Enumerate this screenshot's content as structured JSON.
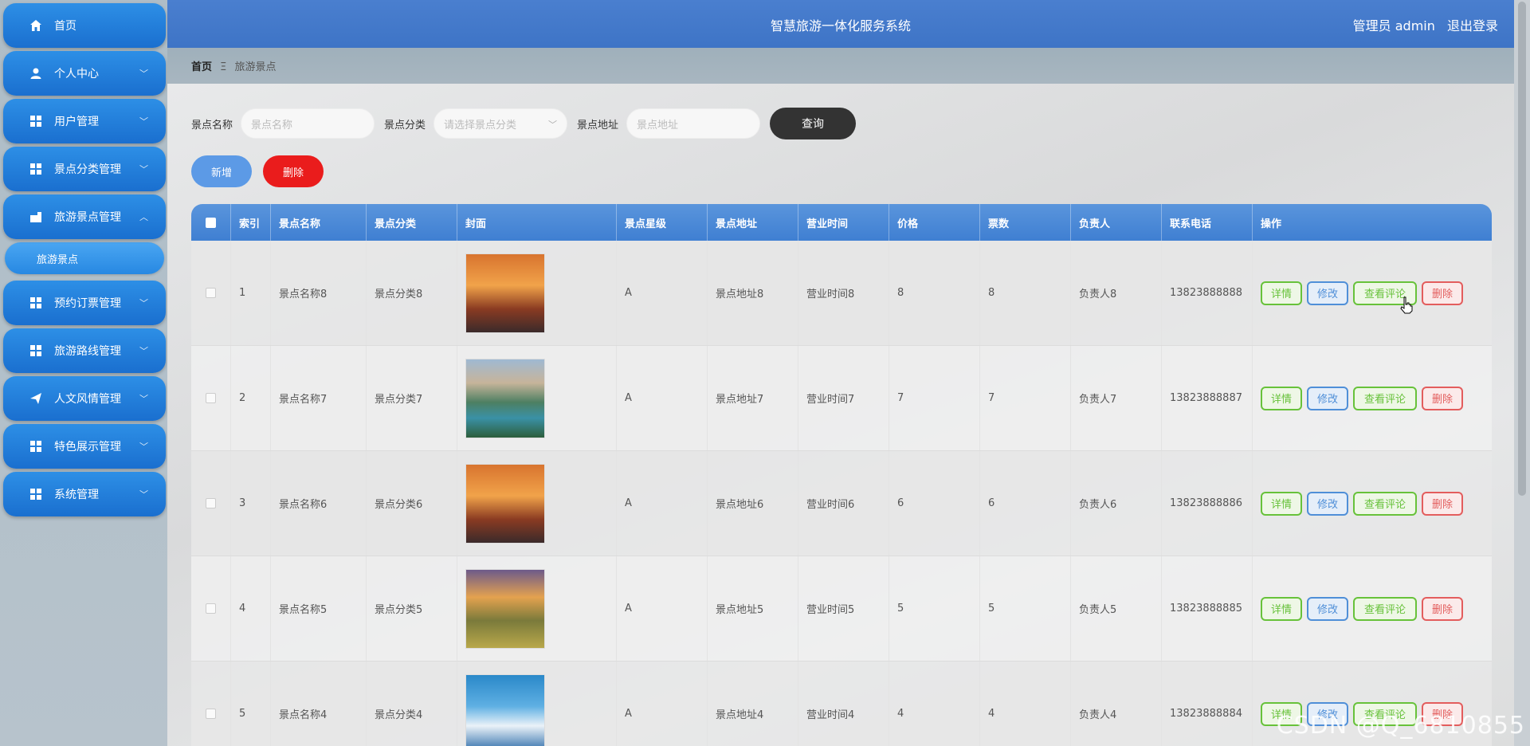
{
  "header": {
    "title": "智慧旅游一体化服务系统",
    "user_label": "管理员 admin",
    "logout_label": "退出登录"
  },
  "sidebar": {
    "items": [
      {
        "label": "首页",
        "icon": "home-icon"
      },
      {
        "label": "个人中心",
        "icon": "person-icon"
      },
      {
        "label": "用户管理",
        "icon": "grid-icon"
      },
      {
        "label": "景点分类管理",
        "icon": "grid-icon"
      },
      {
        "label": "旅游景点管理",
        "icon": "building-icon"
      },
      {
        "label": "预约订票管理",
        "icon": "grid-icon"
      },
      {
        "label": "旅游路线管理",
        "icon": "grid-icon"
      },
      {
        "label": "人文风情管理",
        "icon": "send-icon"
      },
      {
        "label": "特色展示管理",
        "icon": "grid-icon"
      },
      {
        "label": "系统管理",
        "icon": "grid-icon"
      }
    ],
    "submenu_active": "旅游景点"
  },
  "breadcrumb": {
    "home": "首页",
    "separator": "Ξ",
    "current": "旅游景点"
  },
  "search": {
    "name_label": "景点名称",
    "name_placeholder": "景点名称",
    "category_label": "景点分类",
    "category_placeholder": "请选择景点分类",
    "address_label": "景点地址",
    "address_placeholder": "景点地址",
    "query_label": "查询"
  },
  "actions": {
    "add_label": "新增",
    "delete_label": "删除"
  },
  "table": {
    "headers": [
      "索引",
      "景点名称",
      "景点分类",
      "封面",
      "景点星级",
      "景点地址",
      "营业时间",
      "价格",
      "票数",
      "负责人",
      "联系电话",
      "操作"
    ],
    "ops": {
      "detail": "详情",
      "edit": "修改",
      "review": "查看评论",
      "delete": "删除"
    },
    "rows": [
      {
        "index": "1",
        "name": "景点名称8",
        "category": "景点分类8",
        "cover": "sunset",
        "star": "A",
        "address": "景点地址8",
        "hours": "营业时间8",
        "price": "8",
        "tickets": "8",
        "owner": "负责人8",
        "phone": "13823888888"
      },
      {
        "index": "2",
        "name": "景点名称7",
        "category": "景点分类7",
        "cover": "lake",
        "star": "A",
        "address": "景点地址7",
        "hours": "营业时间7",
        "price": "7",
        "tickets": "7",
        "owner": "负责人7",
        "phone": "13823888887"
      },
      {
        "index": "3",
        "name": "景点名称6",
        "category": "景点分类6",
        "cover": "sunset",
        "star": "A",
        "address": "景点地址6",
        "hours": "营业时间6",
        "price": "6",
        "tickets": "6",
        "owner": "负责人6",
        "phone": "13823888886"
      },
      {
        "index": "4",
        "name": "景点名称5",
        "category": "景点分类5",
        "cover": "meadow",
        "star": "A",
        "address": "景点地址5",
        "hours": "营业时间5",
        "price": "5",
        "tickets": "5",
        "owner": "负责人5",
        "phone": "13823888885"
      },
      {
        "index": "5",
        "name": "景点名称4",
        "category": "景点分类4",
        "cover": "sea",
        "star": "A",
        "address": "景点地址4",
        "hours": "营业时间4",
        "price": "4",
        "tickets": "4",
        "owner": "负责人4",
        "phone": "13823888884"
      }
    ]
  },
  "watermark": "CSDN @Q_6810855",
  "colors": {
    "header": "#3e74c6",
    "menu": "#1a6fcf",
    "query_button": "#333333",
    "add_button": "#5c9ae6",
    "delete_button": "#ea1c1c"
  }
}
